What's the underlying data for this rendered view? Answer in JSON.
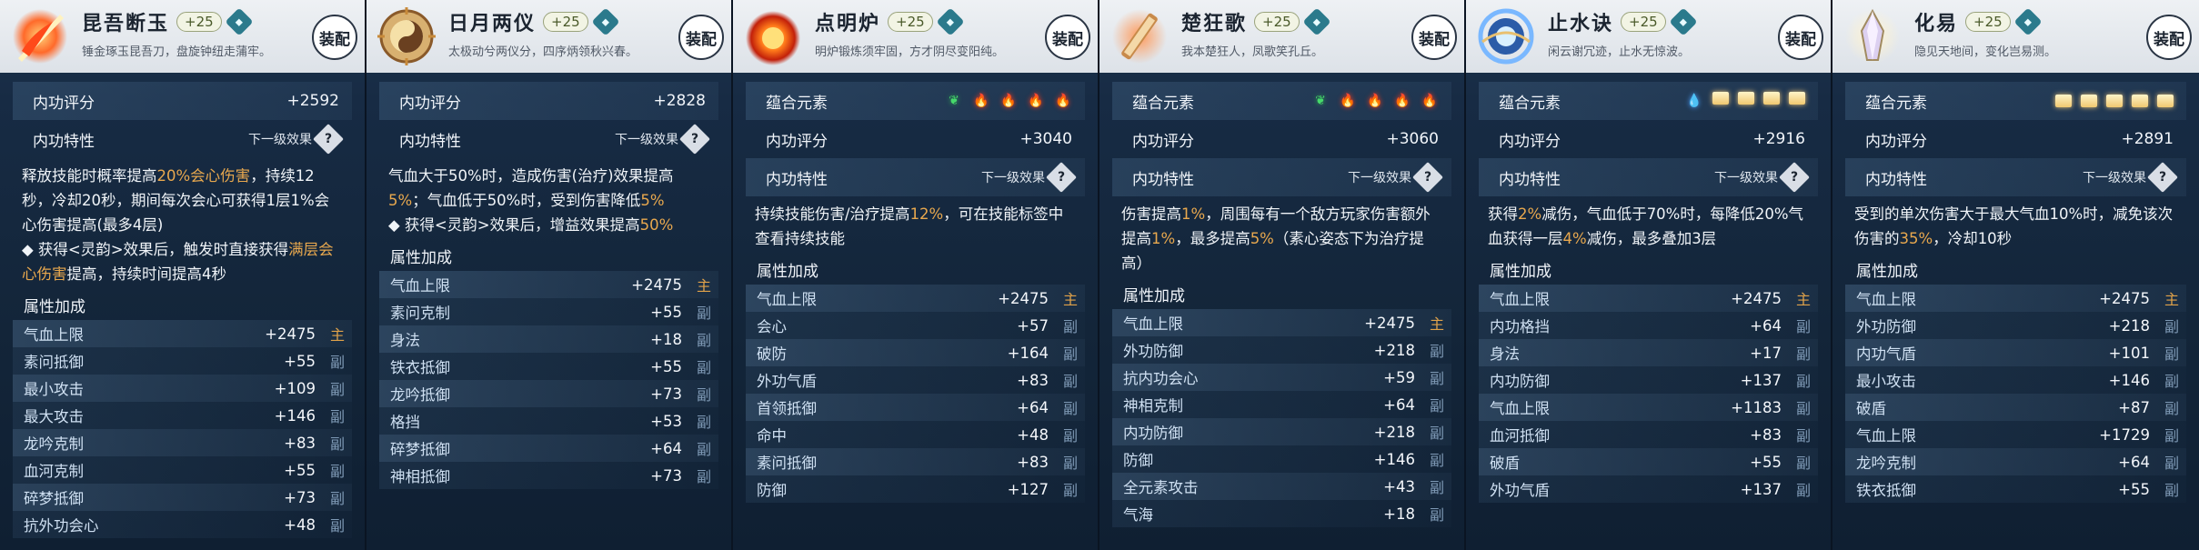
{
  "panels": [
    {
      "name": "昆吾断玉",
      "level": "+25",
      "gem": "⬥",
      "desc": "锤金琢玉昆吾刀，盘旋钟纽走蒲牢。",
      "equip": "装配",
      "art": "fire-sword",
      "elements_label": "",
      "elements": [],
      "score_label": "内功评分",
      "score": "+2592",
      "trait_label": "内功特性",
      "next_label": "下一级效果",
      "text": [
        {
          "t": "释放技能时概率提高"
        },
        {
          "t": "20%会心伤害",
          "h": true
        },
        {
          "t": "，持续12秒，冷却20秒，期间每次会心可获得1层1%会心伤害提高(最多4层)"
        },
        {
          "t": "\n◆ 获得<灵韵>效果后，触发时直接获得"
        },
        {
          "t": "满层会心伤害",
          "h": true
        },
        {
          "t": "提高，持续时间提高4秒"
        }
      ],
      "attr_label": "属性加成",
      "stats": [
        {
          "n": "气血上限",
          "v": "+2475",
          "tag": "主",
          "k": "main"
        },
        {
          "n": "素问抵御",
          "v": "+55",
          "tag": "副",
          "k": "sub"
        },
        {
          "n": "最小攻击",
          "v": "+109",
          "tag": "副",
          "k": "sub"
        },
        {
          "n": "最大攻击",
          "v": "+146",
          "tag": "副",
          "k": "sub"
        },
        {
          "n": "龙吟克制",
          "v": "+83",
          "tag": "副",
          "k": "sub"
        },
        {
          "n": "血河克制",
          "v": "+55",
          "tag": "副",
          "k": "sub"
        },
        {
          "n": "碎梦抵御",
          "v": "+73",
          "tag": "副",
          "k": "sub"
        },
        {
          "n": "抗外功会心",
          "v": "+48",
          "tag": "副",
          "k": "sub"
        }
      ]
    },
    {
      "name": "日月两仪",
      "level": "+25",
      "gem": "⬥",
      "desc": "太极动兮两仪分，四序炳领秋兴春。",
      "equip": "装配",
      "art": "sun-moon",
      "elements_label": "",
      "elements": [],
      "score_label": "内功评分",
      "score": "+2828",
      "trait_label": "内功特性",
      "next_label": "下一级效果",
      "text": [
        {
          "t": "气血大于50%时，造成伤害(治疗)效果提高"
        },
        {
          "t": "5%",
          "h": true
        },
        {
          "t": "；气血低于50%时，受到伤害降低"
        },
        {
          "t": "5%",
          "h": true
        },
        {
          "t": "\n◆ 获得<灵韵>效果后，增益效果提高"
        },
        {
          "t": "50%",
          "h": true
        }
      ],
      "attr_label": "属性加成",
      "stats": [
        {
          "n": "气血上限",
          "v": "+2475",
          "tag": "主",
          "k": "main"
        },
        {
          "n": "素问克制",
          "v": "+55",
          "tag": "副",
          "k": "sub"
        },
        {
          "n": "身法",
          "v": "+18",
          "tag": "副",
          "k": "sub"
        },
        {
          "n": "铁衣抵御",
          "v": "+55",
          "tag": "副",
          "k": "sub"
        },
        {
          "n": "龙吟抵御",
          "v": "+73",
          "tag": "副",
          "k": "sub"
        },
        {
          "n": "格挡",
          "v": "+53",
          "tag": "副",
          "k": "sub"
        },
        {
          "n": "碎梦抵御",
          "v": "+64",
          "tag": "副",
          "k": "sub"
        },
        {
          "n": "神相抵御",
          "v": "+73",
          "tag": "副",
          "k": "sub"
        }
      ]
    },
    {
      "name": "点明炉",
      "level": "+25",
      "gem": "⬥",
      "desc": "明炉锻炼须牢固，方才阴尽变阳纯。",
      "equip": "装配",
      "art": "fire-orb",
      "elements_label": "蕴合元素",
      "elements": [
        "leaf",
        "fire",
        "fire",
        "fire",
        "fire"
      ],
      "score_label": "内功评分",
      "score": "+3040",
      "trait_label": "内功特性",
      "next_label": "下一级效果",
      "text": [
        {
          "t": "持续技能伤害/治疗提高"
        },
        {
          "t": "12%",
          "h": true
        },
        {
          "t": "，可在技能标签中查看持续技能"
        }
      ],
      "attr_label": "属性加成",
      "stats": [
        {
          "n": "气血上限",
          "v": "+2475",
          "tag": "主",
          "k": "main"
        },
        {
          "n": "会心",
          "v": "+57",
          "tag": "副",
          "k": "sub"
        },
        {
          "n": "破防",
          "v": "+164",
          "tag": "副",
          "k": "sub"
        },
        {
          "n": "外功气盾",
          "v": "+83",
          "tag": "副",
          "k": "sub"
        },
        {
          "n": "首领抵御",
          "v": "+64",
          "tag": "副",
          "k": "sub"
        },
        {
          "n": "命中",
          "v": "+48",
          "tag": "副",
          "k": "sub"
        },
        {
          "n": "素问抵御",
          "v": "+83",
          "tag": "副",
          "k": "sub"
        },
        {
          "n": "防御",
          "v": "+127",
          "tag": "副",
          "k": "sub"
        }
      ]
    },
    {
      "name": "楚狂歌",
      "level": "+25",
      "gem": "⬥",
      "desc": "我本楚狂人，凤歌笑孔丘。",
      "equip": "装配",
      "art": "scroll",
      "elements_label": "蕴合元素",
      "elements": [
        "leaf",
        "fire",
        "fire",
        "fire",
        "fire"
      ],
      "score_label": "内功评分",
      "score": "+3060",
      "trait_label": "内功特性",
      "next_label": "下一级效果",
      "text": [
        {
          "t": "伤害提高"
        },
        {
          "t": "1%",
          "h": true
        },
        {
          "t": "，周围每有一个敌方玩家伤害额外提高"
        },
        {
          "t": "1%",
          "h": true
        },
        {
          "t": "，最多提高"
        },
        {
          "t": "5%",
          "h": true
        },
        {
          "t": "（素心姿态下为治疗提高）"
        }
      ],
      "attr_label": "属性加成",
      "stats": [
        {
          "n": "气血上限",
          "v": "+2475",
          "tag": "主",
          "k": "main"
        },
        {
          "n": "外功防御",
          "v": "+218",
          "tag": "副",
          "k": "sub"
        },
        {
          "n": "抗内功会心",
          "v": "+59",
          "tag": "副",
          "k": "sub"
        },
        {
          "n": "神相克制",
          "v": "+64",
          "tag": "副",
          "k": "sub"
        },
        {
          "n": "内功防御",
          "v": "+218",
          "tag": "副",
          "k": "sub"
        },
        {
          "n": "防御",
          "v": "+146",
          "tag": "副",
          "k": "sub"
        },
        {
          "n": "全元素攻击",
          "v": "+43",
          "tag": "副",
          "k": "sub"
        },
        {
          "n": "气海",
          "v": "+18",
          "tag": "副",
          "k": "sub"
        }
      ]
    },
    {
      "name": "止水诀",
      "level": "+25",
      "gem": "⬥",
      "desc": "闲云谢冗迹，止水无惊波。",
      "equip": "装配",
      "art": "water-ring",
      "elements_label": "蕴合元素",
      "elements": [
        "water",
        "gold",
        "gold",
        "gold",
        "gold"
      ],
      "score_label": "内功评分",
      "score": "+2916",
      "trait_label": "内功特性",
      "next_label": "下一级效果",
      "text": [
        {
          "t": "获得"
        },
        {
          "t": "2%",
          "h": true
        },
        {
          "t": "减伤，气血低于70%时，每降低20%气血获得一层"
        },
        {
          "t": "4%",
          "h": true
        },
        {
          "t": "减伤，最多叠加3层"
        }
      ],
      "attr_label": "属性加成",
      "stats": [
        {
          "n": "气血上限",
          "v": "+2475",
          "tag": "主",
          "k": "main"
        },
        {
          "n": "内功格挡",
          "v": "+64",
          "tag": "副",
          "k": "sub"
        },
        {
          "n": "身法",
          "v": "+17",
          "tag": "副",
          "k": "sub"
        },
        {
          "n": "内功防御",
          "v": "+137",
          "tag": "副",
          "k": "sub"
        },
        {
          "n": "气血上限",
          "v": "+1183",
          "tag": "副",
          "k": "sub"
        },
        {
          "n": "血河抵御",
          "v": "+83",
          "tag": "副",
          "k": "sub"
        },
        {
          "n": "破盾",
          "v": "+55",
          "tag": "副",
          "k": "sub"
        },
        {
          "n": "外功气盾",
          "v": "+137",
          "tag": "副",
          "k": "sub"
        }
      ]
    },
    {
      "name": "化易",
      "level": "+25",
      "gem": "⬥",
      "desc": "隐见天地间，变化岂易测。",
      "equip": "装配",
      "art": "crystal",
      "elements_label": "蕴合元素",
      "elements": [
        "gold",
        "gold",
        "gold",
        "gold",
        "gold"
      ],
      "score_label": "内功评分",
      "score": "+2891",
      "trait_label": "内功特性",
      "next_label": "下一级效果",
      "text": [
        {
          "t": "受到的单次伤害大于最大气血10%时，减免该次伤害的"
        },
        {
          "t": "35%",
          "h": true
        },
        {
          "t": "，冷却10秒"
        }
      ],
      "attr_label": "属性加成",
      "stats": [
        {
          "n": "气血上限",
          "v": "+2475",
          "tag": "主",
          "k": "main"
        },
        {
          "n": "外功防御",
          "v": "+218",
          "tag": "副",
          "k": "sub"
        },
        {
          "n": "内功气盾",
          "v": "+101",
          "tag": "副",
          "k": "sub"
        },
        {
          "n": "最小攻击",
          "v": "+146",
          "tag": "副",
          "k": "sub"
        },
        {
          "n": "破盾",
          "v": "+87",
          "tag": "副",
          "k": "sub"
        },
        {
          "n": "气血上限",
          "v": "+1729",
          "tag": "副",
          "k": "sub"
        },
        {
          "n": "龙吟克制",
          "v": "+64",
          "tag": "副",
          "k": "sub"
        },
        {
          "n": "铁衣抵御",
          "v": "+55",
          "tag": "副",
          "k": "sub"
        }
      ]
    }
  ],
  "colors": {
    "highlight": "#e8a84e",
    "main_tag": "#e0a24a",
    "sub_tag": "#7f9ab6",
    "panel_bg": "#172b44",
    "header_bg": "#eef1f4"
  },
  "question_glyph": "?"
}
